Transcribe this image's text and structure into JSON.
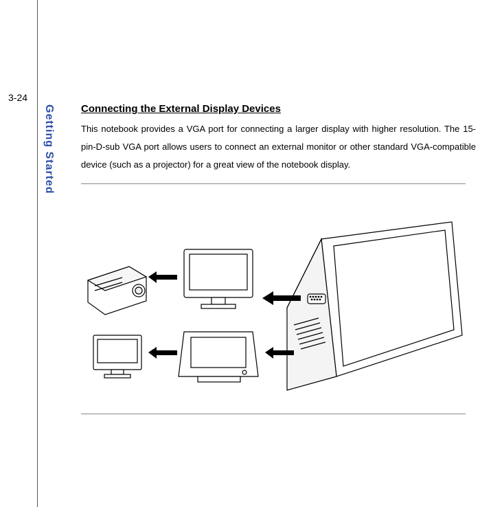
{
  "page_number": "3-24",
  "sidebar_label": "Getting Started",
  "heading": "Connecting the External Display Devices",
  "body": "This notebook provides a VGA port for connecting a larger display with higher resolution.  The 15-pin-D-sub VGA port allows users to connect an external monitor or other standard VGA-compatible device (such as a projector) for a great view of the notebook display."
}
